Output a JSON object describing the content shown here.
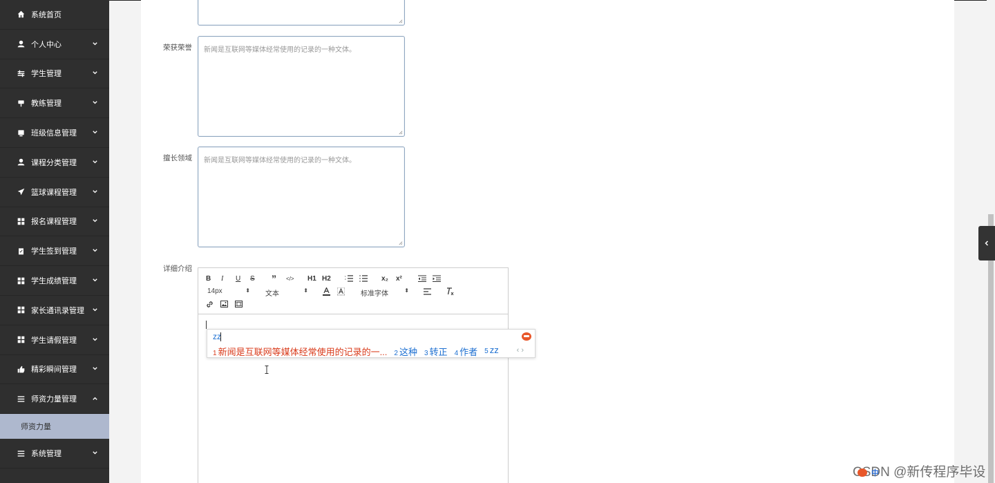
{
  "sidebar": {
    "items": [
      {
        "label": "系统首页",
        "icon": "home-icon",
        "has_chevron": false
      },
      {
        "label": "个人中心",
        "icon": "user-icon",
        "has_chevron": true
      },
      {
        "label": "学生管理",
        "icon": "sliders-icon",
        "has_chevron": true
      },
      {
        "label": "教练管理",
        "icon": "stamp-icon",
        "has_chevron": true
      },
      {
        "label": "班级信息管理",
        "icon": "tablet-icon",
        "has_chevron": true
      },
      {
        "label": "课程分类管理",
        "icon": "user-icon",
        "has_chevron": true
      },
      {
        "label": "篮球课程管理",
        "icon": "paper-plane-icon",
        "has_chevron": true
      },
      {
        "label": "报名课程管理",
        "icon": "grid-icon",
        "has_chevron": true
      },
      {
        "label": "学生签到管理",
        "icon": "clipboard-check-icon",
        "has_chevron": true
      },
      {
        "label": "学生成绩管理",
        "icon": "grid-icon",
        "has_chevron": true
      },
      {
        "label": "家长通讯录管理",
        "icon": "grid-icon",
        "has_chevron": true
      },
      {
        "label": "学生请假管理",
        "icon": "grid-icon",
        "has_chevron": true
      },
      {
        "label": "精彩瞬间管理",
        "icon": "thumbs-up-icon",
        "has_chevron": true
      },
      {
        "label": "师资力量管理",
        "icon": "list-icon",
        "has_chevron": true,
        "expanded": true
      }
    ],
    "sub_item": "师资力量",
    "last_item": {
      "label": "系统管理",
      "icon": "list-icon"
    }
  },
  "form": {
    "honors": {
      "label": "荣获荣誉",
      "placeholder": "新闻是互联网等媒体经常使用的记录的一种文体。"
    },
    "expertise": {
      "label": "擅长领域",
      "placeholder": "新闻是互联网等媒体经常使用的记录的一种文体。"
    },
    "detail": {
      "label": "详细介绍"
    }
  },
  "editor": {
    "row1": [
      "B",
      "I",
      "U",
      "S",
      "”",
      "</>",
      "H1",
      "H2",
      "ol",
      "ul",
      "x₂",
      "x²",
      "outdent",
      "indent"
    ],
    "font_size": "14px",
    "header": "文本",
    "font_family": "标准字体",
    "body_text": ""
  },
  "ime": {
    "input": "zz",
    "candidates": [
      {
        "n": "1",
        "text": "新闻是互联网等媒体经常使用的记录的一..."
      },
      {
        "n": "2",
        "text": "这种"
      },
      {
        "n": "3",
        "text": "转正"
      },
      {
        "n": "4",
        "text": "作者"
      },
      {
        "n": "5",
        "text": "zz"
      }
    ],
    "nav": "‹ ›"
  },
  "watermark": "CSDN @新传程序毕设",
  "tray_text": "中"
}
